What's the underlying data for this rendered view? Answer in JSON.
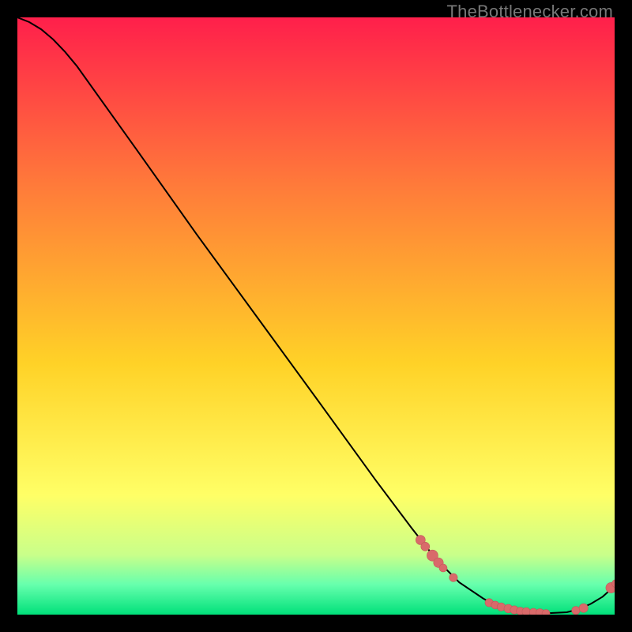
{
  "watermark": "TheBottlenecker.com",
  "colors": {
    "frame": "#000000",
    "curve": "#000000",
    "marker_fill": "#d96a6a",
    "marker_stroke": "#c25a5a",
    "grad_top": "#ff1f4b",
    "grad_upper": "#ff7a3a",
    "grad_mid": "#ffd227",
    "grad_lower": "#ffff66",
    "grad_green1": "#c9ff8a",
    "grad_green2": "#66ffad",
    "grad_green3": "#00e07a"
  },
  "chart_data": {
    "type": "line",
    "title": "",
    "xlabel": "",
    "ylabel": "",
    "xlim": [
      0,
      100
    ],
    "ylim": [
      0,
      100
    ],
    "legend": false,
    "grid": false,
    "curve": [
      {
        "x": 0,
        "y": 100
      },
      {
        "x": 2,
        "y": 99.2
      },
      {
        "x": 4,
        "y": 98.0
      },
      {
        "x": 6,
        "y": 96.3
      },
      {
        "x": 8,
        "y": 94.2
      },
      {
        "x": 10,
        "y": 91.8
      },
      {
        "x": 14,
        "y": 86.2
      },
      {
        "x": 20,
        "y": 77.8
      },
      {
        "x": 30,
        "y": 63.7
      },
      {
        "x": 40,
        "y": 50.0
      },
      {
        "x": 50,
        "y": 36.3
      },
      {
        "x": 60,
        "y": 22.5
      },
      {
        "x": 66,
        "y": 14.5
      },
      {
        "x": 70,
        "y": 9.4
      },
      {
        "x": 74,
        "y": 5.4
      },
      {
        "x": 78,
        "y": 2.7
      },
      {
        "x": 80,
        "y": 1.6
      },
      {
        "x": 84,
        "y": 0.6
      },
      {
        "x": 88,
        "y": 0.2
      },
      {
        "x": 92,
        "y": 0.4
      },
      {
        "x": 94,
        "y": 0.9
      },
      {
        "x": 96,
        "y": 1.8
      },
      {
        "x": 98,
        "y": 3.0
      },
      {
        "x": 100,
        "y": 4.8
      }
    ],
    "markers": [
      {
        "x": 67.5,
        "y": 12.5,
        "r": 6.0
      },
      {
        "x": 68.3,
        "y": 11.4,
        "r": 5.5
      },
      {
        "x": 69.5,
        "y": 9.9,
        "r": 7.0
      },
      {
        "x": 70.5,
        "y": 8.7,
        "r": 6.2
      },
      {
        "x": 71.3,
        "y": 7.8,
        "r": 5.0
      },
      {
        "x": 73.0,
        "y": 6.2,
        "r": 5.2
      },
      {
        "x": 79.0,
        "y": 2.0,
        "r": 5.2
      },
      {
        "x": 80.0,
        "y": 1.6,
        "r": 5.0
      },
      {
        "x": 81.0,
        "y": 1.3,
        "r": 5.2
      },
      {
        "x": 82.2,
        "y": 1.0,
        "r": 5.4
      },
      {
        "x": 83.2,
        "y": 0.8,
        "r": 5.2
      },
      {
        "x": 84.2,
        "y": 0.6,
        "r": 5.0
      },
      {
        "x": 85.2,
        "y": 0.5,
        "r": 5.2
      },
      {
        "x": 86.4,
        "y": 0.4,
        "r": 5.0
      },
      {
        "x": 87.5,
        "y": 0.3,
        "r": 5.2
      },
      {
        "x": 88.5,
        "y": 0.2,
        "r": 5.0
      },
      {
        "x": 93.5,
        "y": 0.7,
        "r": 5.2
      },
      {
        "x": 94.8,
        "y": 1.1,
        "r": 5.6
      },
      {
        "x": 99.4,
        "y": 4.5,
        "r": 6.6
      },
      {
        "x": 100.2,
        "y": 5.2,
        "r": 5.0
      }
    ]
  }
}
